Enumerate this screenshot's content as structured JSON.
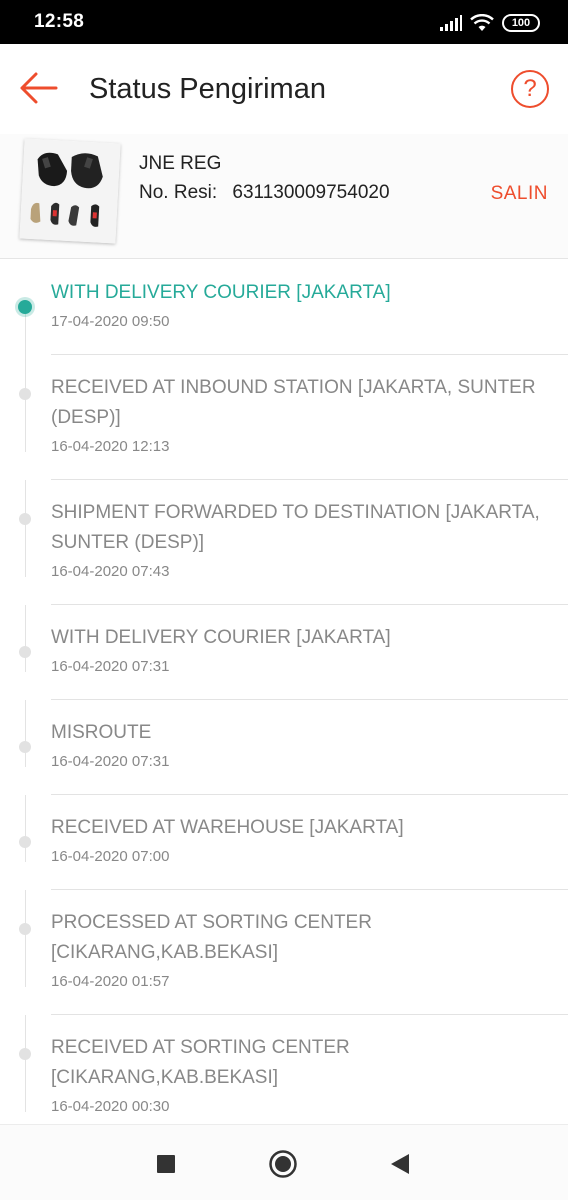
{
  "status_bar": {
    "time": "12:58",
    "battery": "100",
    "icons": [
      "signal-icon",
      "wifi-icon",
      "battery-icon"
    ]
  },
  "app_bar": {
    "title": "Status Pengiriman",
    "back_icon": "arrow-left-icon",
    "help_icon": "question-circle-icon",
    "help_symbol": "?"
  },
  "shipment": {
    "courier": "JNE REG",
    "resi_label": "No. Resi:",
    "resi_number": "631130009754020",
    "copy_label": "SALIN"
  },
  "timeline": [
    {
      "status": "WITH DELIVERY COURIER [JAKARTA]",
      "datetime": "17-04-2020 09:50",
      "active": true
    },
    {
      "status": "RECEIVED AT INBOUND STATION [JAKARTA, SUNTER (DESP)]",
      "datetime": "16-04-2020 12:13",
      "active": false
    },
    {
      "status": "SHIPMENT FORWARDED TO DESTINATION [JAKARTA, SUNTER (DESP)]",
      "datetime": "16-04-2020 07:43",
      "active": false
    },
    {
      "status": "WITH DELIVERY COURIER [JAKARTA]",
      "datetime": "16-04-2020 07:31",
      "active": false
    },
    {
      "status": "MISROUTE",
      "datetime": "16-04-2020 07:31",
      "active": false
    },
    {
      "status": "RECEIVED AT WAREHOUSE [JAKARTA]",
      "datetime": "16-04-2020 07:00",
      "active": false
    },
    {
      "status": "PROCESSED AT SORTING CENTER [CIKARANG,KAB.BEKASI]",
      "datetime": "16-04-2020 01:57",
      "active": false
    },
    {
      "status": "RECEIVED AT SORTING CENTER [CIKARANG,KAB.BEKASI]",
      "datetime": "16-04-2020 00:30",
      "active": false
    }
  ],
  "nav_bar": {
    "icons": [
      "recents-square-icon",
      "home-circle-icon",
      "back-triangle-icon"
    ]
  },
  "colors": {
    "accent": "#ee4d2d",
    "active_status": "#26aa99",
    "inactive_text": "#888888"
  }
}
